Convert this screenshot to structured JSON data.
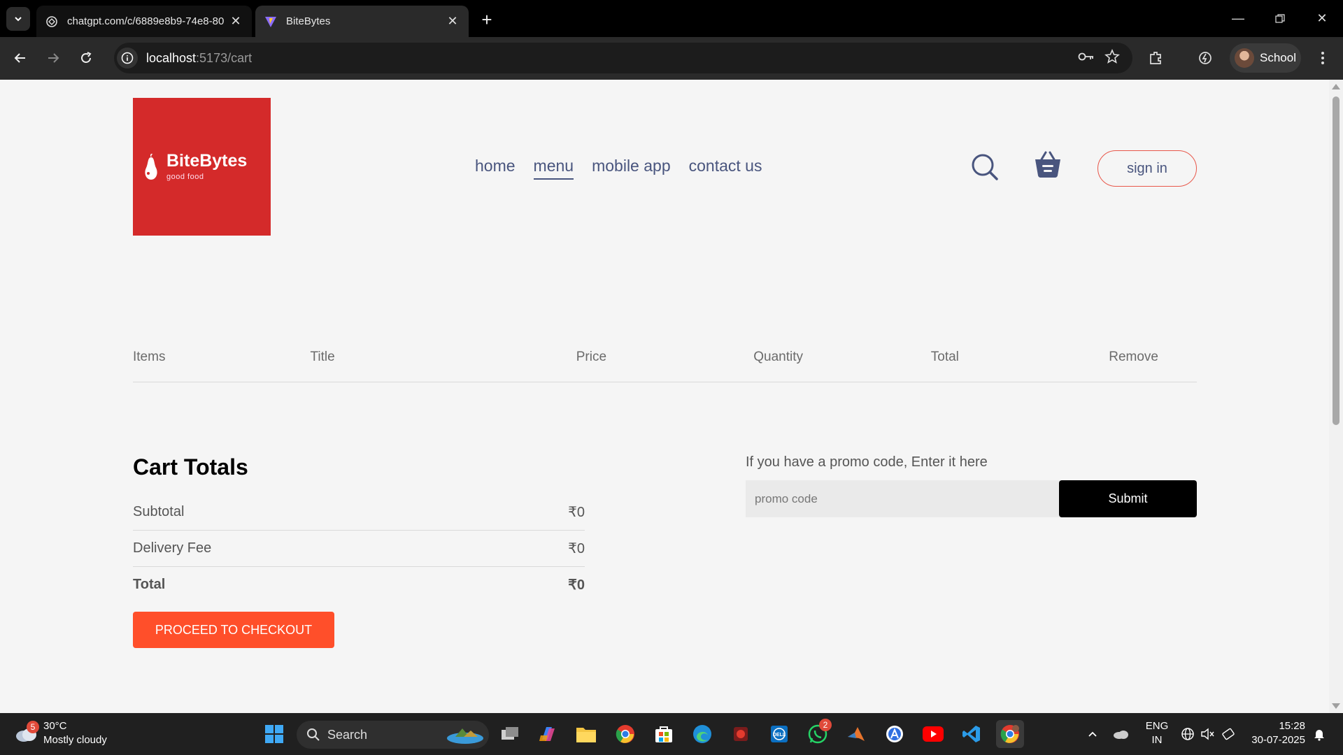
{
  "browser": {
    "tabs": [
      {
        "title": "chatgpt.com/c/6889e8b9-74e8-80",
        "active": false,
        "favicon": "chatgpt-icon"
      },
      {
        "title": "BiteBytes",
        "active": true,
        "favicon": "vite-icon"
      }
    ],
    "url_host": "localhost",
    "url_path": ":5173/cart",
    "profile_name": "School"
  },
  "page": {
    "logo": {
      "brand": "BiteBytes",
      "tagline": "good food",
      "color": "#d42a2a"
    },
    "nav": {
      "items": [
        "home",
        "menu",
        "mobile app",
        "contact us"
      ],
      "active": "menu"
    },
    "sign_in_label": "sign in",
    "cart_columns": [
      "Items",
      "Title",
      "Price",
      "Quantity",
      "Total",
      "Remove"
    ],
    "totals": {
      "title": "Cart Totals",
      "subtotal_label": "Subtotal",
      "subtotal_value": "₹0",
      "delivery_label": "Delivery Fee",
      "delivery_value": "₹0",
      "total_label": "Total",
      "total_value": "₹0",
      "checkout_label": "PROCEED TO CHECKOUT"
    },
    "promo": {
      "prompt": "If you have a promo code, Enter it here",
      "placeholder": "promo code",
      "submit_label": "Submit"
    },
    "accent_color": "#ff4f2a",
    "nav_text_color": "#49557e"
  },
  "taskbar": {
    "weather_temp": "30°C",
    "weather_desc": "Mostly cloudy",
    "weather_badge": "5",
    "search_label": "Search",
    "whatsapp_badge": "2",
    "lang_line1": "ENG",
    "lang_line2": "IN",
    "time": "15:28",
    "date": "30-07-2025"
  }
}
